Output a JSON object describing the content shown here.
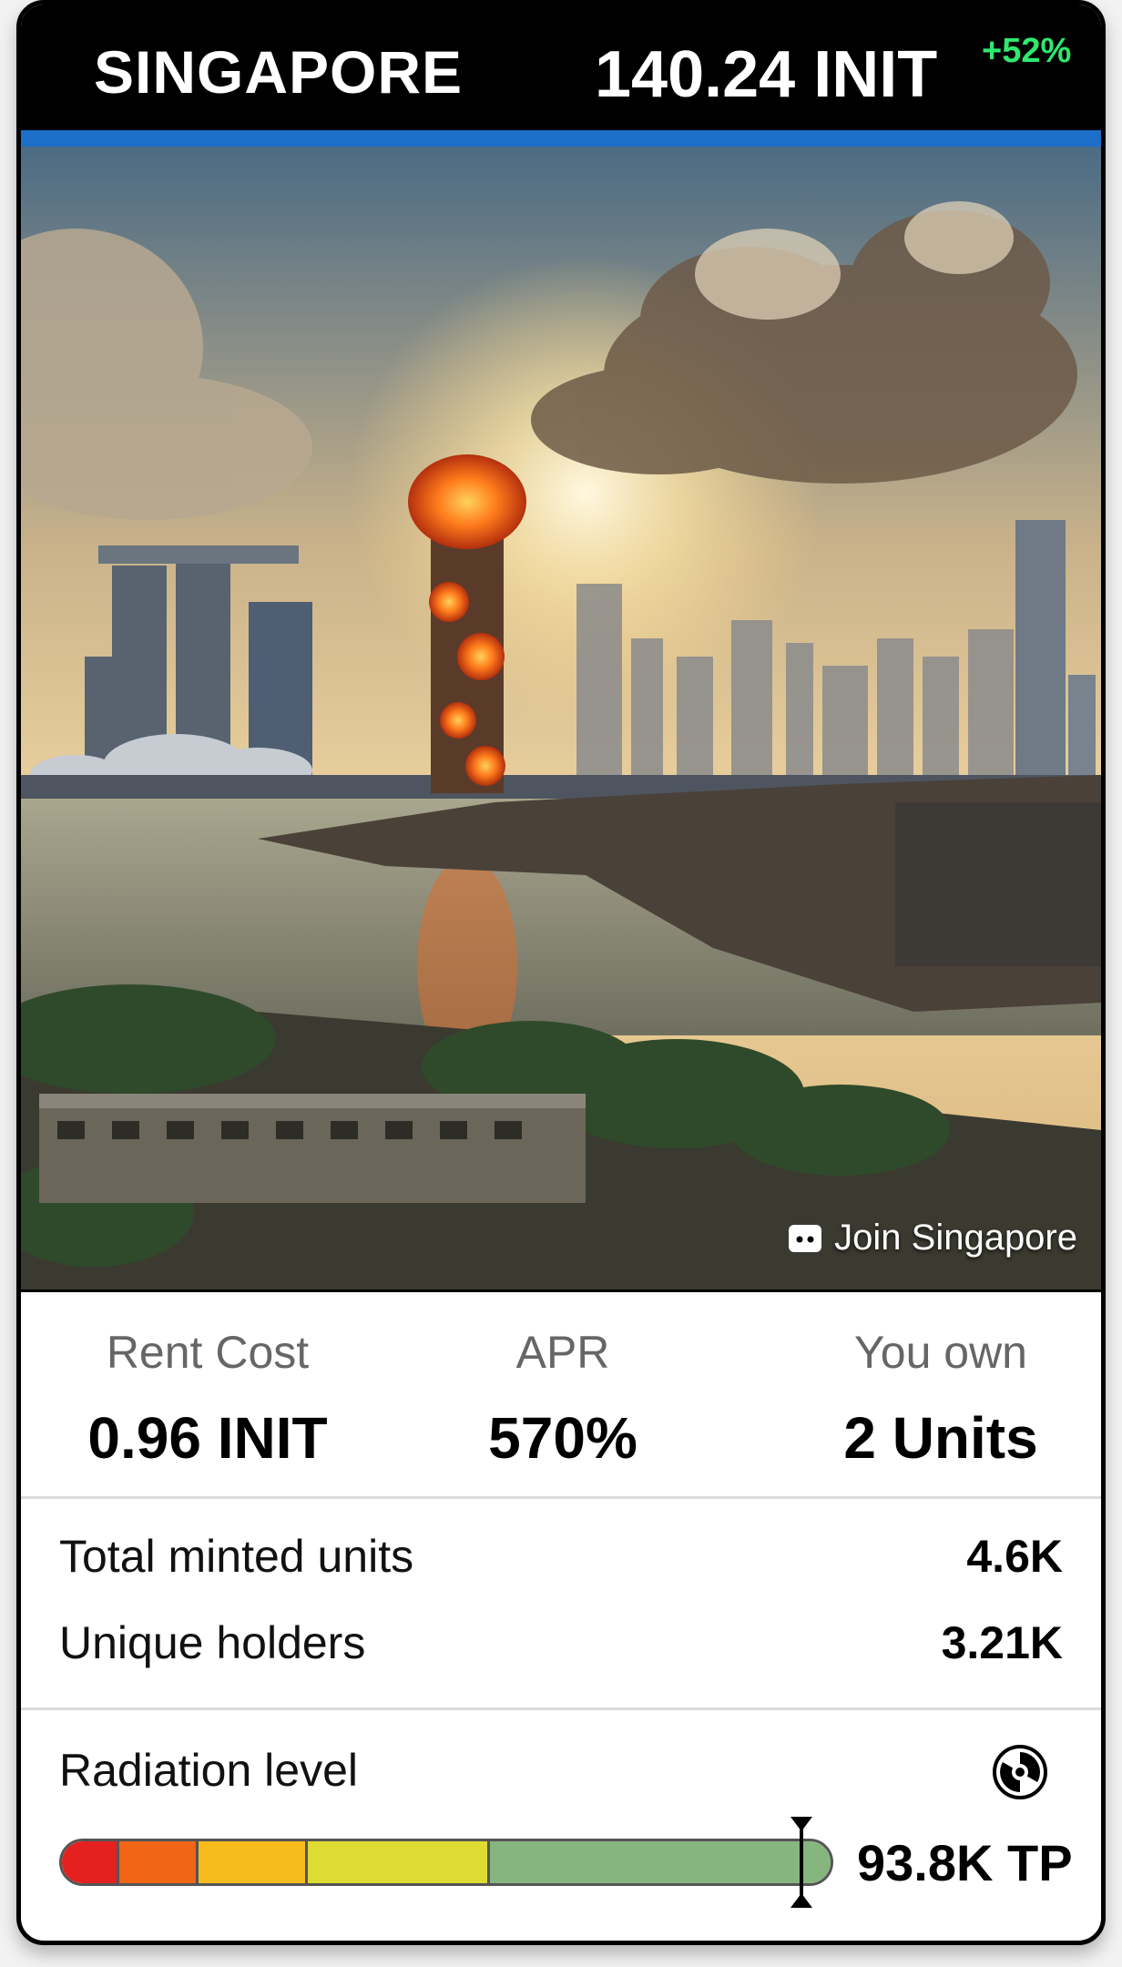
{
  "header": {
    "city": "SINGAPORE",
    "price": "140.24 INIT",
    "change": "+52%",
    "accent_color": "#1d6fc9",
    "change_color": "#2ee86f"
  },
  "hero": {
    "join_label": "Join Singapore",
    "join_icon": "discord-icon"
  },
  "stats": [
    {
      "label": "Rent Cost",
      "value": "0.96 INIT"
    },
    {
      "label": "APR",
      "value": "570%"
    },
    {
      "label": "You own",
      "value": "2 Units"
    }
  ],
  "details": [
    {
      "label": "Total minted units",
      "value": "4.6K"
    },
    {
      "label": "Unique holders",
      "value": "3.21K"
    }
  ],
  "radiation": {
    "label": "Radiation level",
    "icon": "radiation-icon",
    "value": "93.8K TP",
    "level_fraction": 0.93,
    "segment_colors": [
      "#e4211f",
      "#f06516",
      "#f7bb1c",
      "#dedb32",
      "#86b57e"
    ]
  }
}
